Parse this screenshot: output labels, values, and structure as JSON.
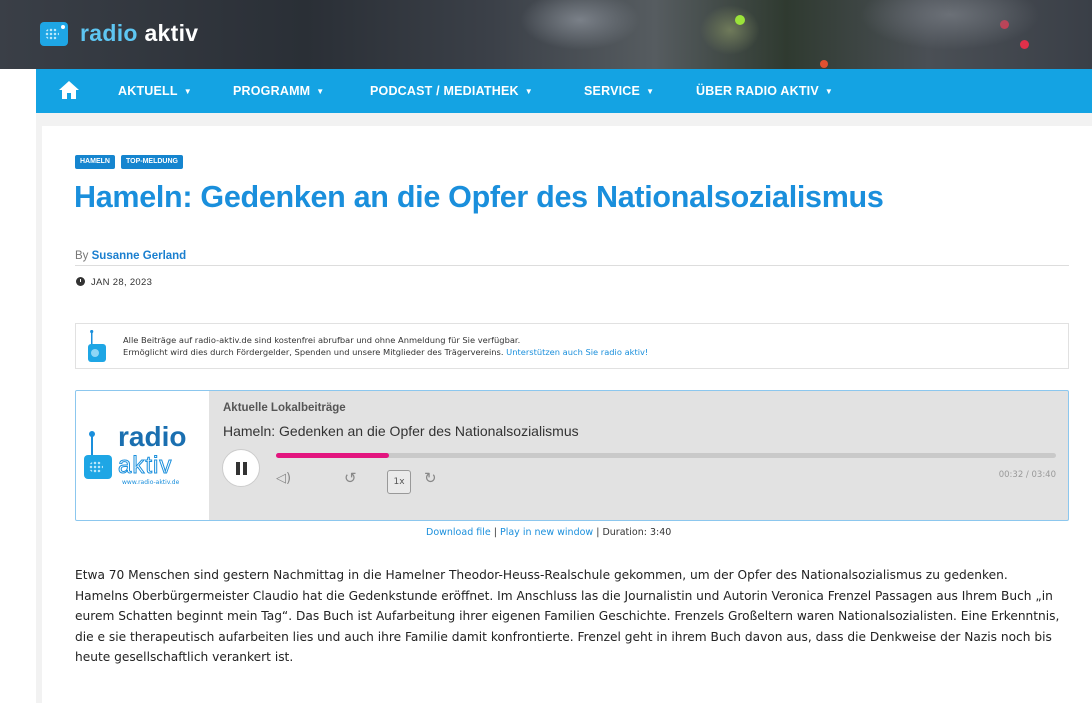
{
  "header": {
    "logo_part1": "radio",
    "logo_part2": "aktiv"
  },
  "nav": {
    "items": [
      {
        "label": "AKTUELL"
      },
      {
        "label": "PROGRAMM"
      },
      {
        "label": "PODCAST / MEDIATHEK"
      },
      {
        "label": "SERVICE"
      },
      {
        "label": "ÜBER RADIO AKTIV"
      }
    ]
  },
  "article": {
    "tags": [
      "HAMELN",
      "TOP-MELDUNG"
    ],
    "title": "Hameln: Gedenken an die Opfer des Nationalsozialismus",
    "by_prefix": "By",
    "author": "Susanne Gerland",
    "date": "JAN 28, 2023"
  },
  "notice": {
    "line1": "Alle Beiträge auf radio-aktiv.de sind kostenfrei abrufbar und ohne Anmeldung für Sie verfügbar.",
    "line2": "Ermöglicht wird dies durch Fördergelder, Spenden und unsere Mitglieder des Trägervereins.",
    "link": "Unterstützen auch Sie radio aktiv!"
  },
  "player": {
    "cover_radio": "radio",
    "cover_aktiv": "aktiv",
    "cover_url": "www.radio-aktiv.de",
    "label": "Aktuelle Lokalbeiträge",
    "title": "Hameln: Gedenken an die Opfer des Nationalsozialismus",
    "progress_fraction": 0.145,
    "rate": "1x",
    "time": "00:32 / 03:40",
    "colors": {
      "progress": "#e3157f"
    }
  },
  "downloads": {
    "download_label": "Download file",
    "separator1": "|",
    "play_label": "Play in new window",
    "separator2": "|",
    "duration": "Duration: 3:40"
  },
  "body": {
    "paragraph1": "Etwa 70 Menschen sind gestern Nachmittag in die Hamelner Theodor-Heuss-Realschule gekommen, um der Opfer des Nationalsozialismus zu gedenken.",
    "paragraph2": "Hamelns Oberbürgermeister Claudio hat die Gedenkstunde eröffnet. Im Anschluss las die Journalistin und Autorin Veronica Frenzel Passagen aus Ihrem Buch „in eurem Schatten beginnt mein Tag“. Das Buch ist Aufarbeitung ihrer eigenen Familien Geschichte. Frenzels Großeltern waren Nationalsozialisten. Eine Erkenntnis, die e sie therapeutisch aufarbeiten lies und auch ihre Familie damit konfrontierte. Frenzel geht in ihrem Buch davon aus, dass die Denkweise der Nazis noch bis heute gesellschaftlich verankert ist."
  }
}
